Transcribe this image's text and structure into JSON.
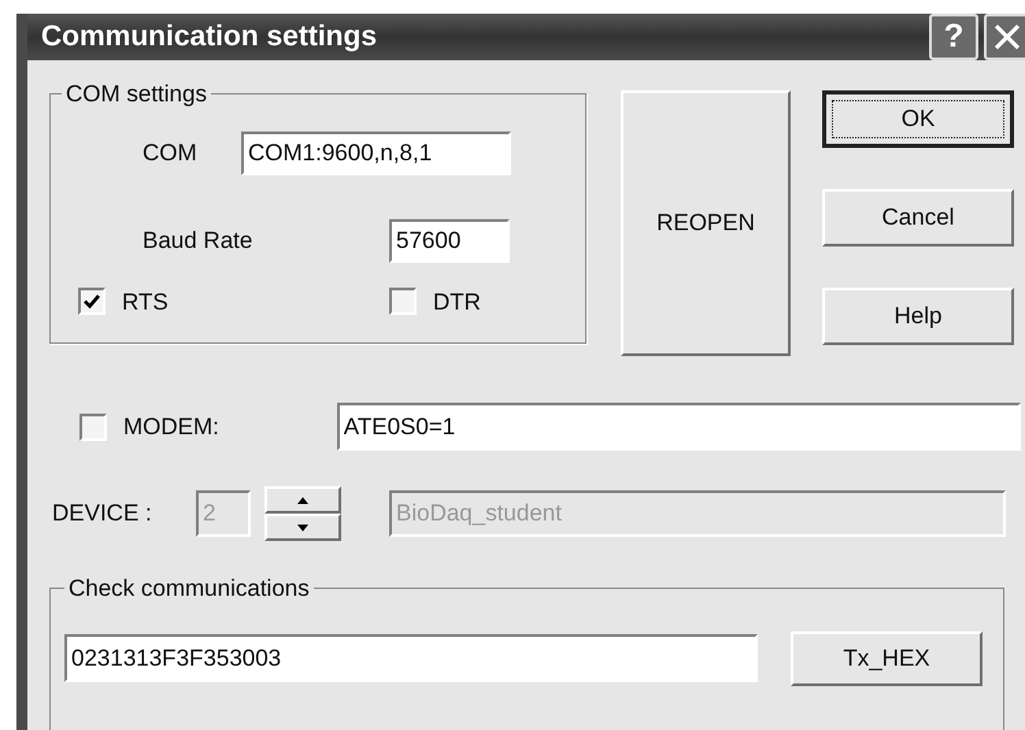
{
  "window": {
    "title": "Communication settings",
    "help_glyph": "?"
  },
  "com_settings": {
    "title": "COM settings",
    "com": {
      "label": "COM",
      "value": "COM1:9600,n,8,1"
    },
    "baud_rate": {
      "label": "Baud Rate",
      "value": "57600"
    },
    "checkboxes": [
      {
        "label": "RTS",
        "checked": true
      },
      {
        "label": "DTR",
        "checked": false
      }
    ]
  },
  "reopen_button": "REOPEN",
  "buttons": [
    {
      "label": "OK",
      "default": true
    },
    {
      "label": "Cancel",
      "default": false
    },
    {
      "label": "Help",
      "default": false
    }
  ],
  "modem": {
    "label": "MODEM:",
    "checked": false,
    "value": "ATE0S0=1"
  },
  "device": {
    "label": "DEVICE :",
    "value": "2",
    "name": "BioDaq_student",
    "disabled": true
  },
  "check_communications": {
    "title": "Check communications",
    "value": "0231313F3F353003",
    "button": "Tx_HEX"
  }
}
